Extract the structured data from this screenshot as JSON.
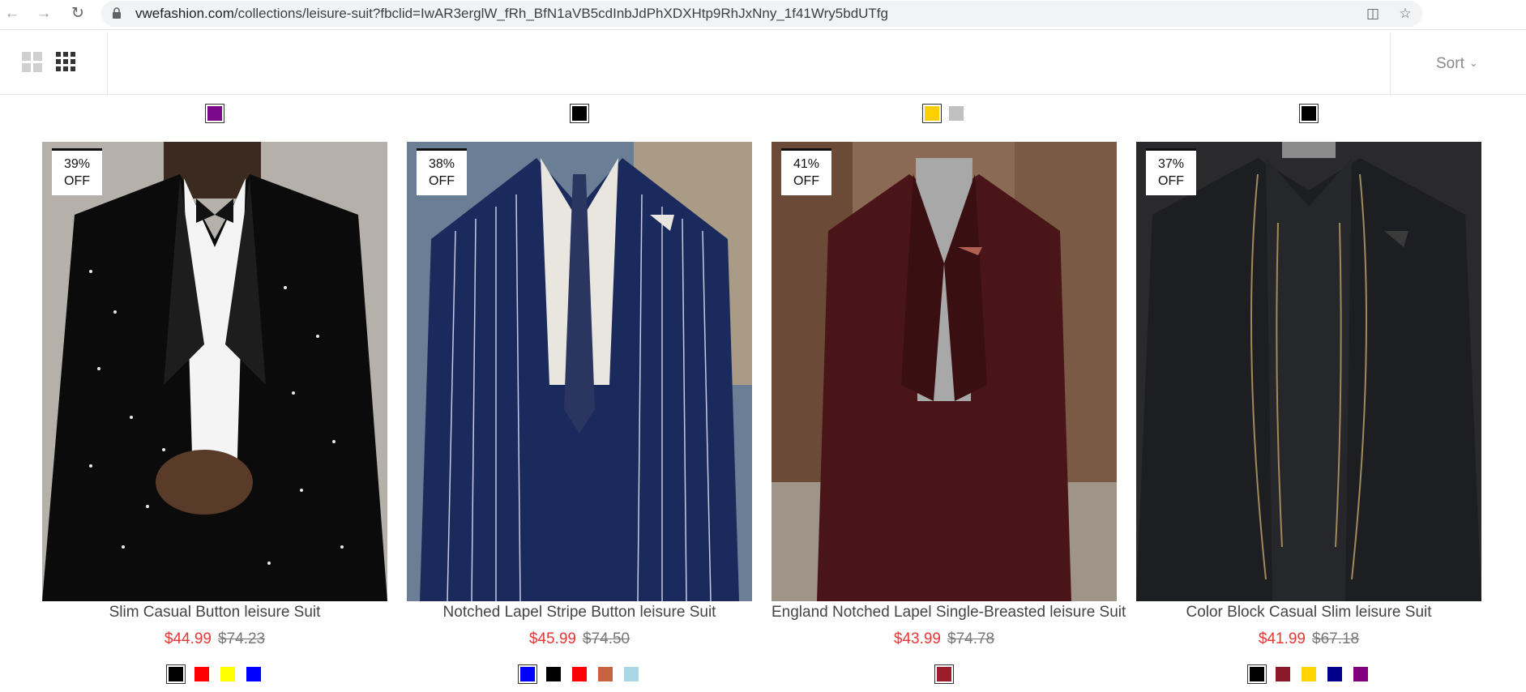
{
  "browser": {
    "url_host": "vwefashion.com",
    "url_path": "/collections/leisure-suit?fbclid=IwAR3erglW_fRh_BfN1aVB5cdInbJdPhXDXHtp9RhJxNny_1f41Wry5bdUTfg"
  },
  "toolbar": {
    "sort_label": "Sort"
  },
  "products": [
    {
      "name": "Slim Casual Button leisure Suit",
      "price": "$44.99",
      "compare_price": "$74.23",
      "discount_pct": "39%",
      "discount_label": "OFF",
      "top_swatches": [
        "#7b0a8a"
      ],
      "bottom_swatches": [
        "#000000",
        "#ff0000",
        "#ffff00",
        "#0000ff"
      ]
    },
    {
      "name": "Notched Lapel Stripe Button leisure Suit",
      "price": "$45.99",
      "compare_price": "$74.50",
      "discount_pct": "38%",
      "discount_label": "OFF",
      "top_swatches": [
        "#000000"
      ],
      "bottom_swatches": [
        "#0000ff",
        "#000000",
        "#ff0000",
        "#c7643e",
        "#a8d8e8"
      ]
    },
    {
      "name": "England Notched Lapel Single-Breasted leisure Suit",
      "price": "$43.99",
      "compare_price": "$74.78",
      "discount_pct": "41%",
      "discount_label": "OFF",
      "top_swatches": [
        "#ffd000",
        "#c0c0c0"
      ],
      "bottom_swatches": [
        "#9b1c2b"
      ]
    },
    {
      "name": "Color Block Casual Slim leisure Suit",
      "price": "$41.99",
      "compare_price": "$67.18",
      "discount_pct": "37%",
      "discount_label": "OFF",
      "top_swatches": [
        "#000000"
      ],
      "bottom_swatches": [
        "#000000",
        "#8b1a28",
        "#ffd400",
        "#00008b",
        "#800080"
      ]
    }
  ]
}
